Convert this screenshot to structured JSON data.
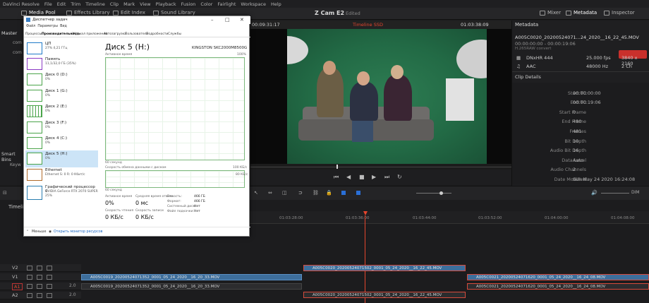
{
  "menu": [
    "DaVinci Resolve",
    "File",
    "Edit",
    "Trim",
    "Timeline",
    "Clip",
    "Mark",
    "View",
    "Playback",
    "Fusion",
    "Color",
    "Fairlight",
    "Workspace",
    "Help"
  ],
  "toolbar": {
    "media_pool": "Media Pool",
    "effects": "Effects Library",
    "edit_index": "Edit Index",
    "sound": "Sound Library",
    "mixer": "Mixer",
    "metadata": "Metadata",
    "inspector": "Inspector"
  },
  "project": {
    "name": "Z Cam E2",
    "status": "Edited"
  },
  "viewer": {
    "left_tc": "00:09:31:17",
    "timeline_name": "Timeline SSD",
    "right_tc": "01:03:38:09"
  },
  "left_panel": {
    "master": "Master",
    "smart_bins": "Smart Bins",
    "keywords": "Keyw",
    "items": [
      "com",
      "com"
    ]
  },
  "metadata": {
    "title": "Metadata",
    "clip_name": "A005C0020_20200524071...24_2020__16_22_45.MOV",
    "tc": "00:00:00:00 - 00:00:19:06",
    "codec_note": "H.265RAW convert",
    "video": {
      "codec": "DNxHR 444",
      "fps": "25.000 fps",
      "res": "3840 x 2160"
    },
    "audio": {
      "codec": "AAC",
      "rate": "48000 Hz",
      "ch": "2 Ch"
    },
    "section": "Clip Details",
    "details": [
      {
        "k": "Start TC",
        "v": "00:00:00:00"
      },
      {
        "k": "End TC",
        "v": "00:00:19:06"
      },
      {
        "k": "Start Frame",
        "v": "0"
      },
      {
        "k": "End Frame",
        "v": "480"
      },
      {
        "k": "Frames",
        "v": "481"
      },
      {
        "k": "Bit Depth",
        "v": "10"
      },
      {
        "k": "Audio Bit Depth",
        "v": "16"
      },
      {
        "k": "Data Level",
        "v": "Auto"
      },
      {
        "k": "Audio Channels",
        "v": "2"
      },
      {
        "k": "Date Modified",
        "v": "Sun May 24 2020 16:24:08"
      }
    ]
  },
  "timeline": {
    "label": "Timeline",
    "ruler": [
      "01:03:28:00",
      "01:03:36:00",
      "01:03:44:00",
      "01:03:52:00",
      "01:04:00:00",
      "01:04:08:00"
    ],
    "tracks": [
      {
        "name": "V2",
        "num": ""
      },
      {
        "name": "V1",
        "num": ""
      },
      {
        "name": "A1",
        "num": "2.0"
      },
      {
        "name": "A2",
        "num": "2.0"
      }
    ],
    "clips": {
      "v2_a": "A005C0020_20200524071502_0001_05_24_2020__16_22_45.MOV",
      "v1_a": "A005C0019_20200524071352_0001_05_24_2020__16_20_33.MOV",
      "v1_b": "A005C0021_20200524071620_0001_05_24_2020__16_24_08.MOV",
      "a1_a": "A005C0019_20200524071352_0001_05_24_2020__16_20_33.MOV",
      "a1_b": "A005C0021_20200524071620_0001_05_24_2020__16_24_08.MOV",
      "a2_a": "A005C0020_20200524071502_0001_05_24_2020__16_22_45.MOV"
    }
  },
  "taskmgr": {
    "title": "Диспетчер задач",
    "menus": [
      "Файл",
      "Параметры",
      "Вид"
    ],
    "tabs": [
      "Процессы",
      "Производительность",
      "Журнал приложений",
      "Автозагрузка",
      "Пользователи",
      "Подробности",
      "Службы"
    ],
    "items": [
      {
        "name": "ЦП",
        "sub": "27% 4,21 ГГц",
        "color": "#1f7ac9"
      },
      {
        "name": "Память",
        "sub": "11,1/32,0 ГБ (35%)",
        "color": "#8b3ac4"
      },
      {
        "name": "Диск 0 (D:)",
        "sub": "0%",
        "color": "#4aa44a"
      },
      {
        "name": "Диск 1 (G:)",
        "sub": "0%",
        "color": "#4aa44a"
      },
      {
        "name": "Диск 2 (E:)",
        "sub": "0%",
        "color": "#4aa44a"
      },
      {
        "name": "Диск 3 (F:)",
        "sub": "0%",
        "color": "#4aa44a"
      },
      {
        "name": "Диск 4 (C:)",
        "sub": "0%",
        "color": "#4aa44a"
      },
      {
        "name": "Диск 5 (H:)",
        "sub": "0%",
        "color": "#4aa44a"
      },
      {
        "name": "Ethernet",
        "sub": "Ethernet  S: 0 R: 0 Кбит/с",
        "color": "#b06a2a"
      },
      {
        "name": "Графический процессор 0",
        "sub": "NVIDIA GeForce RTX 2070 SUPER  25%",
        "color": "#2a7db0"
      }
    ],
    "disk_title": "Диск 5 (H:)",
    "disk_model": "KINGSTON SKC2000M8500G",
    "graph1_label": "Активное время",
    "graph1_max": "100%",
    "graph1_time": "60 секунд",
    "graph2_label": "Скорость обмена данными с диском",
    "graph2_max": "100 КБ/с",
    "graph2_sub": "80 КБ/с",
    "graph2_time": "60 секунд",
    "stats": {
      "active_label": "Активное время",
      "active": "0%",
      "resp_label": "Средняя время ответа",
      "resp": "0 мс",
      "read_label": "Скорость чтения",
      "read": "0 КБ/с",
      "write_label": "Скорость записи",
      "write": "0 КБ/с",
      "cap_label": "Емкость:",
      "cap": "466 ГБ",
      "fmt_label": "Формат:",
      "fmt": "466 ГБ",
      "sys_label": "Системный диск:",
      "sys": "Нет",
      "pf_label": "Файл подкачки:",
      "pf": "Нет"
    },
    "footer_less": "Меньше",
    "footer_monitor": "Открыть монитор ресурсов"
  },
  "colors": {
    "accent_red": "#e5452d",
    "video_clip": "#3d6e9c",
    "green_screen": "#2e7d53"
  }
}
